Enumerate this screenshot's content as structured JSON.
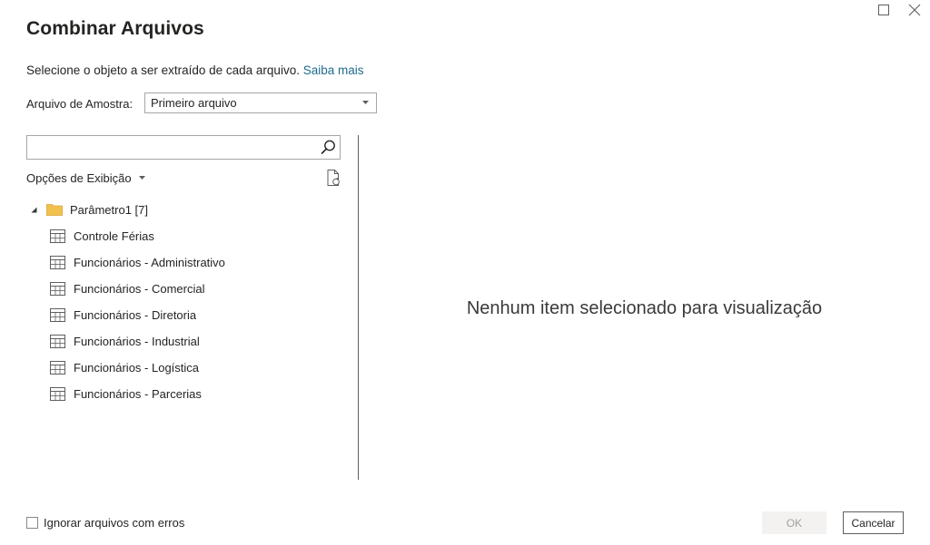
{
  "dialog": {
    "title": "Combinar Arquivos",
    "description": "Selecione o objeto a ser extraído de cada arquivo.",
    "learn_more_link": "Saiba mais"
  },
  "sample_file": {
    "label": "Arquivo de Amostra:",
    "selected": "Primeiro arquivo"
  },
  "navigator": {
    "search_value": "",
    "view_options_label": "Opções de Exibição",
    "tree": {
      "folder": "Parâmetro1 [7]",
      "items": [
        "Controle Férias",
        "Funcionários - Administrativo",
        "Funcionários - Comercial",
        "Funcionários - Diretoria",
        "Funcionários - Industrial",
        "Funcionários - Logística",
        "Funcionários - Parcerias"
      ]
    }
  },
  "preview": {
    "empty_message": "Nenhum item selecionado para visualização"
  },
  "footer": {
    "ignore_errors_label": "Ignorar arquivos com erros",
    "ignore_errors_checked": false,
    "ok_label": "OK",
    "cancel_label": "Cancelar"
  },
  "icons": {
    "maximize": "maximize-icon",
    "close": "close-icon",
    "search": "search-icon",
    "refresh": "refresh-icon",
    "folder": "folder-icon",
    "table": "table-icon"
  },
  "colors": {
    "link": "#1f6b8f",
    "folder": "#f2c14e",
    "disabled_button_bg": "#f3f2f1"
  }
}
